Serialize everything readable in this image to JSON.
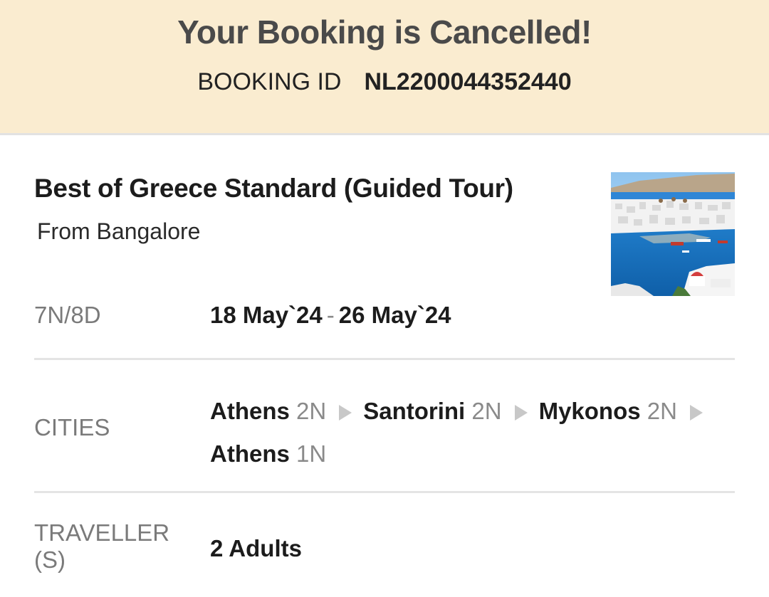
{
  "banner": {
    "title": "Your Booking is Cancelled!",
    "booking_id_label": "BOOKING ID",
    "booking_id": "NL2200044352440",
    "background_color": "#faecd0"
  },
  "tour": {
    "title": "Best of Greece Standard (Guided Tour)",
    "from": "From Bangalore",
    "image_icon": "tour-photo-greece-coast"
  },
  "duration": {
    "label": "7N/8D",
    "start_date": "18 May`24",
    "separator": "-",
    "end_date": "26 May`24"
  },
  "cities": {
    "label": "CITIES",
    "stops": [
      {
        "name": "Athens",
        "nights": "2N"
      },
      {
        "name": "Santorini",
        "nights": "2N"
      },
      {
        "name": "Mykonos",
        "nights": "2N"
      },
      {
        "name": "Athens",
        "nights": "1N"
      }
    ]
  },
  "travellers": {
    "label_line1": "TRAVELLER",
    "label_line2": "(S)",
    "value": "2 Adults"
  }
}
